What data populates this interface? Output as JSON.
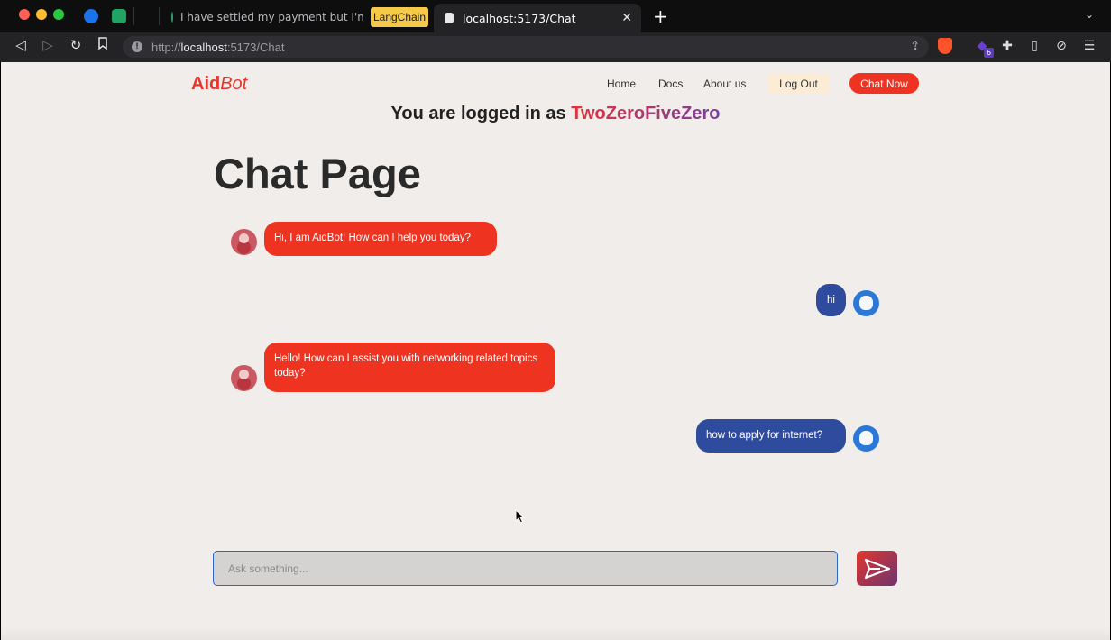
{
  "browser": {
    "tabs": [
      {
        "label": "I have settled my payment but I'm n"
      },
      {
        "label": "LangChain"
      },
      {
        "label": "localhost:5173/Chat"
      }
    ],
    "url_scheme": "http://",
    "url_host": "localhost",
    "url_path": ":5173/Chat",
    "extension_badge": "6"
  },
  "header": {
    "brand_a": "Aid",
    "brand_b": "Bot",
    "nav": {
      "home": "Home",
      "docs": "Docs",
      "about": "About us",
      "logout": "Log Out",
      "chat_now": "Chat Now"
    }
  },
  "login": {
    "prefix": "You are logged in as",
    "username": "TwoZeroFiveZero"
  },
  "page_title": "Chat Page",
  "messages": [
    {
      "role": "bot",
      "text": "Hi, I am AidBot! How can I help you today?"
    },
    {
      "role": "user",
      "text": "hi"
    },
    {
      "role": "bot",
      "text": "Hello! How can I assist you with networking related topics today?"
    },
    {
      "role": "user",
      "text": "how to apply for internet?"
    }
  ],
  "composer": {
    "placeholder": "Ask something..."
  },
  "colors": {
    "accent": "#ef3322",
    "bot_bubble": "#ee3421",
    "user_bubble": "#2f4b9e",
    "input_border": "#2d66c9"
  }
}
